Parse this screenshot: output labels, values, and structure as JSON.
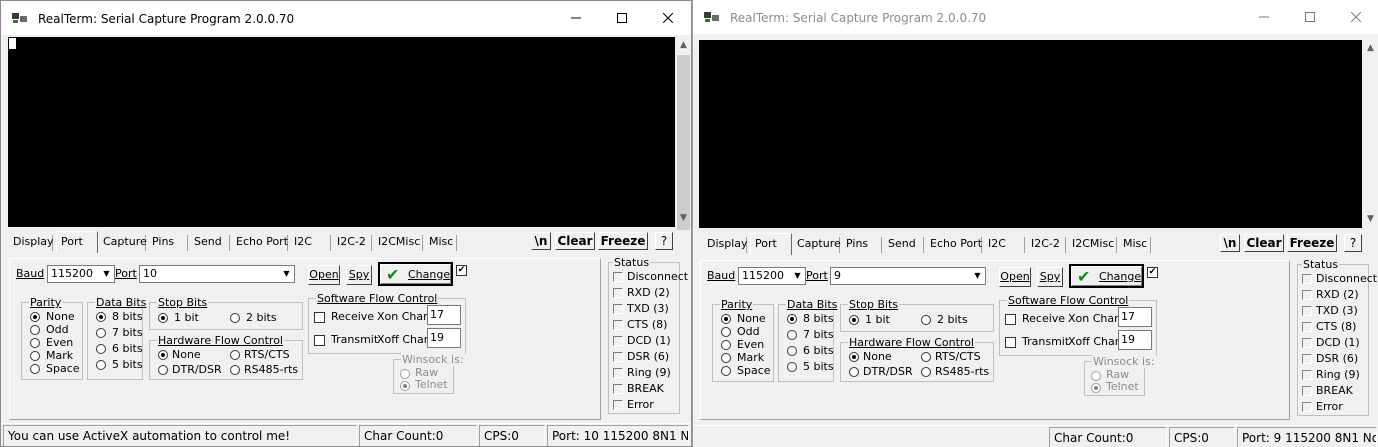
{
  "windows": [
    {
      "id": "win1",
      "title": "RealTerm: Serial Capture Program 2.0.0.70",
      "tabs": [
        "Display",
        "Port",
        "Capture",
        "Pins",
        "Send",
        "Echo Port",
        "I2C",
        "I2C-2",
        "I2CMisc",
        "Misc"
      ],
      "active_tab": "Port",
      "buttons": {
        "newline": "\\n",
        "clear": "Clear",
        "freeze": "Freeze",
        "help": "?"
      },
      "port": {
        "baud_label": "Baud",
        "baud": "115200",
        "port_label": "Port",
        "port": "10",
        "open": "Open",
        "spy": "Spy",
        "change": "Change",
        "parity": {
          "title": "Parity",
          "options": [
            "None",
            "Odd",
            "Even",
            "Mark",
            "Space"
          ],
          "selected": "None"
        },
        "data_bits": {
          "title": "Data Bits",
          "options": [
            "8 bits",
            "7 bits",
            "6 bits",
            "5 bits"
          ],
          "selected": "8 bits"
        },
        "stop_bits": {
          "title": "Stop Bits",
          "options": [
            "1 bit",
            "2 bits"
          ],
          "selected": "1 bit"
        },
        "hw_flow": {
          "title": "Hardware Flow Control",
          "options": [
            "None",
            "RTS/CTS",
            "DTR/DSR",
            "RS485-rts"
          ],
          "selected": "None"
        },
        "sw_flow": {
          "title": "Software Flow Control",
          "receive": "Receive",
          "transmit": "Transmit",
          "xon_label": "Xon Char:",
          "xon": "17",
          "xoff_label": "Xoff Char:",
          "xoff": "19"
        },
        "winsock": {
          "title": "Winsock is:",
          "options": [
            "Raw",
            "Telnet"
          ],
          "selected": "Telnet"
        }
      },
      "status": {
        "title": "Status",
        "items": [
          "Disconnect",
          "RXD (2)",
          "TXD (3)",
          "CTS (8)",
          "DCD (1)",
          "DSR (6)",
          "Ring (9)",
          "BREAK",
          "Error"
        ]
      },
      "statusbar": {
        "message": "You can use ActiveX automation to control me!",
        "char_count": "Char Count:0",
        "cps": "CPS:0",
        "port_info": "Port: 10 115200 8N1 No"
      }
    },
    {
      "id": "win2",
      "title": "RealTerm: Serial Capture Program 2.0.0.70",
      "tabs": [
        "Display",
        "Port",
        "Capture",
        "Pins",
        "Send",
        "Echo Port",
        "I2C",
        "I2C-2",
        "I2CMisc",
        "Misc"
      ],
      "active_tab": "Port",
      "buttons": {
        "newline": "\\n",
        "clear": "Clear",
        "freeze": "Freeze",
        "help": "?"
      },
      "port": {
        "baud_label": "Baud",
        "baud": "115200",
        "port_label": "Port",
        "port": "9",
        "open": "Open",
        "spy": "Spy",
        "change": "Change",
        "parity": {
          "title": "Parity",
          "options": [
            "None",
            "Odd",
            "Even",
            "Mark",
            "Space"
          ],
          "selected": "None"
        },
        "data_bits": {
          "title": "Data Bits",
          "options": [
            "8 bits",
            "7 bits",
            "6 bits",
            "5 bits"
          ],
          "selected": "8 bits"
        },
        "stop_bits": {
          "title": "Stop Bits",
          "options": [
            "1 bit",
            "2 bits"
          ],
          "selected": "1 bit"
        },
        "hw_flow": {
          "title": "Hardware Flow Control",
          "options": [
            "None",
            "RTS/CTS",
            "DTR/DSR",
            "RS485-rts"
          ],
          "selected": "None"
        },
        "sw_flow": {
          "title": "Software Flow Control",
          "receive": "Receive",
          "transmit": "Transmit",
          "xon_label": "Xon Char:",
          "xon": "17",
          "xoff_label": "Xoff Char:",
          "xoff": "19"
        },
        "winsock": {
          "title": "Winsock is:",
          "options": [
            "Raw",
            "Telnet"
          ],
          "selected": "Telnet"
        }
      },
      "status": {
        "title": "Status",
        "items": [
          "Disconnect",
          "RXD (2)",
          "TXD (3)",
          "CTS (8)",
          "DCD (1)",
          "DSR (6)",
          "Ring (9)",
          "BREAK",
          "Error"
        ]
      },
      "statusbar": {
        "message": "",
        "char_count": "Char Count:0",
        "cps": "CPS:0",
        "port_info": "Port: 9 115200 8N1 Non"
      }
    }
  ]
}
